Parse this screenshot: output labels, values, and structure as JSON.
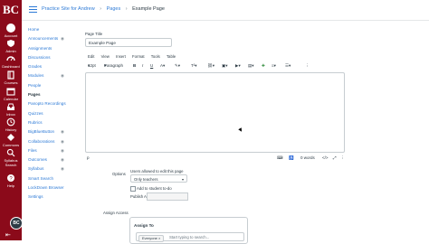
{
  "global_nav": {
    "logo": "BC",
    "items": [
      {
        "label": "Account",
        "icon": "user-icon"
      },
      {
        "label": "Admin",
        "icon": "shield-icon"
      },
      {
        "label": "Dashboard",
        "icon": "dashboard-icon"
      },
      {
        "label": "Courses",
        "icon": "book-icon"
      },
      {
        "label": "Calendar",
        "icon": "calendar-icon"
      },
      {
        "label": "Inbox",
        "icon": "inbox-icon"
      },
      {
        "label": "History",
        "icon": "clock-icon"
      },
      {
        "label": "Commons",
        "icon": "commons-icon"
      },
      {
        "label": "Syllabus Search",
        "icon": "search-icon"
      },
      {
        "label": "Help",
        "icon": "help-icon"
      }
    ],
    "bottom_badge": "BC",
    "collapse_icon": "collapse-arrow-icon",
    "accent": "#8b0a1a"
  },
  "breadcrumb": {
    "course": "Practice Site for Andrew",
    "section": "Pages",
    "current": "Example Page"
  },
  "course_nav": [
    {
      "label": "Home",
      "hidden": false
    },
    {
      "label": "Announcements",
      "hidden": true
    },
    {
      "label": "Assignments",
      "hidden": false
    },
    {
      "label": "Discussions",
      "hidden": false
    },
    {
      "label": "Grades",
      "hidden": false
    },
    {
      "label": "Modules",
      "hidden": true
    },
    {
      "label": "People",
      "hidden": false
    },
    {
      "label": "Pages",
      "hidden": false,
      "active": true
    },
    {
      "label": "Panopto Recordings",
      "hidden": false
    },
    {
      "label": "Quizzes",
      "hidden": false
    },
    {
      "label": "Rubrics",
      "hidden": false
    },
    {
      "label": "BigBlueButton",
      "hidden": true
    },
    {
      "label": "Collaborations",
      "hidden": true
    },
    {
      "label": "Files",
      "hidden": true
    },
    {
      "label": "Outcomes",
      "hidden": true
    },
    {
      "label": "Syllabus",
      "hidden": true
    },
    {
      "label": "Smart Search",
      "hidden": false
    },
    {
      "label": "LockDown Browser",
      "hidden": false
    },
    {
      "label": "Settings",
      "hidden": false
    }
  ],
  "editor": {
    "title_label": "Page Title",
    "title_value": "Example Page",
    "menu": [
      "Edit",
      "View",
      "Insert",
      "Format",
      "Tools",
      "Table"
    ],
    "font_size": "12pt",
    "block_format": "Paragraph",
    "path": "p",
    "word_count": "0 words",
    "html_toggle": "</>"
  },
  "options": {
    "label": "Options",
    "edit_label": "Users allowed to edit this page",
    "edit_value": "Only teachers",
    "todo_label": "Add to student to-do",
    "publish_label": "Publish At"
  },
  "assign": {
    "section_label": "Assign Access",
    "box_title": "Assign To",
    "tag": "Everyone",
    "placeholder": "Start typing to search..."
  }
}
